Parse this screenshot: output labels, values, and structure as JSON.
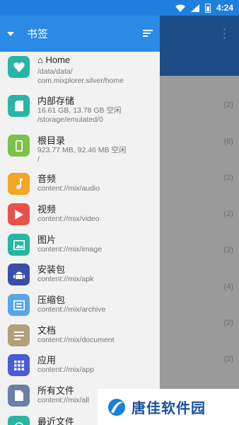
{
  "status_bar": {
    "time": "4:24"
  },
  "drawer": {
    "title": "书签",
    "bookmarks": [
      {
        "name": "⌂ Home",
        "lines": [
          "/data/data/",
          "com.mixplorer.silver/home"
        ],
        "icon": "heart-icon",
        "color": "#27b6a3"
      },
      {
        "name": "内部存储",
        "lines": [
          "16.61 GB, 13.78 GB 空闲",
          "/storage/emulated/0"
        ],
        "icon": "sdcard-icon",
        "color": "#27b6a3"
      },
      {
        "name": "根目录",
        "lines": [
          "923.77 MB, 92.46 MB 空闲",
          "/"
        ],
        "icon": "phone-icon",
        "color": "#7ec14a"
      },
      {
        "name": "音频",
        "lines": [
          "content://mix/audio"
        ],
        "icon": "music-icon",
        "color": "#f5a623"
      },
      {
        "name": "视频",
        "lines": [
          "content://mix/video"
        ],
        "icon": "play-icon",
        "color": "#e8504a"
      },
      {
        "name": "图片",
        "lines": [
          "content://mix/image"
        ],
        "icon": "image-icon",
        "color": "#27b6a3"
      },
      {
        "name": "安装包",
        "lines": [
          "content://mix/apk"
        ],
        "icon": "android-icon",
        "color": "#3a4fa8"
      },
      {
        "name": "压缩包",
        "lines": [
          "content://mix/archive"
        ],
        "icon": "archive-icon",
        "color": "#58a6e8"
      },
      {
        "name": "文档",
        "lines": [
          "content://mix/document"
        ],
        "icon": "document-icon",
        "color": "#b0a07a"
      },
      {
        "name": "应用",
        "lines": [
          "content://mix/app"
        ],
        "icon": "apps-icon",
        "color": "#4a5ad8"
      },
      {
        "name": "所有文件",
        "lines": [
          "content://mix/all"
        ],
        "icon": "file-icon",
        "color": "#6a7fa8"
      },
      {
        "name": "最近文件",
        "lines": [],
        "icon": "recent-icon",
        "color": "#27b6a3"
      }
    ]
  },
  "background_counts": [
    "(2)",
    "(6)",
    "(2)",
    "(2)",
    "(2)",
    "(4)",
    "(2)",
    "(2)"
  ],
  "watermark": {
    "text": "唐佳软件园"
  }
}
